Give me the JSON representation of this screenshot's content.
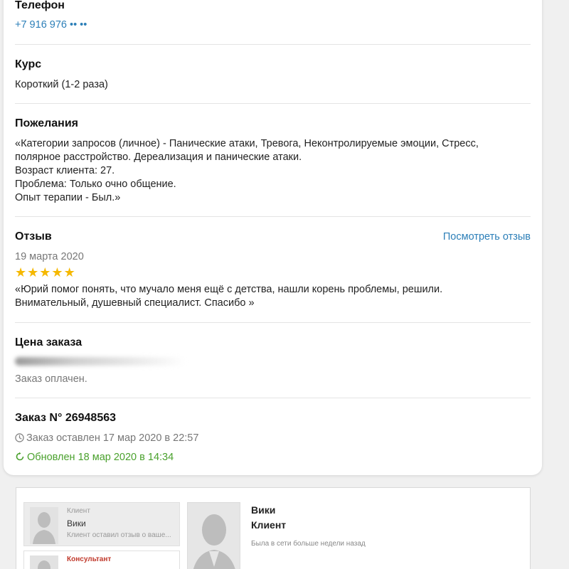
{
  "phone": {
    "label": "Телефон",
    "value": "+7 916 976 •• ••"
  },
  "course": {
    "label": "Курс",
    "value": "Короткий (1-2 раза)"
  },
  "wishes": {
    "label": "Пожелания",
    "lines": [
      "«Категории запросов (личное) - Панические атаки, Тревога, Неконтролируемые эмоции, Стресс,",
      "полярное расстройство. Дереализация и панические атаки.",
      "Возраст клиента: 27.",
      "Проблема: Только очно общение.",
      "Опыт терапии - Был.»"
    ]
  },
  "review": {
    "label": "Отзыв",
    "link": "Посмотреть отзыв",
    "date": "19 марта 2020",
    "rating": 5,
    "stars": [
      "★",
      "★",
      "★",
      "★",
      "★"
    ],
    "lines": [
      "«Юрий помог понять, что мучало меня ещё с детства, нашли корень проблемы, решили.",
      "Внимательный, душевный специалист. Спасибо »"
    ]
  },
  "price": {
    "label": "Цена заказа",
    "status": "Заказ оплачен."
  },
  "order": {
    "title": "Заказ N° 26948563",
    "created": "Заказ оставлен 17 мар 2020 в 22:57",
    "updated": "Обновлен 18 мар 2020 в 14:34"
  },
  "chat": {
    "items": [
      {
        "role": "Клиент",
        "name": "Вики",
        "message": "Клиент оставил отзыв о ваше..."
      },
      {
        "role": "Консультант",
        "name": "",
        "message": ""
      }
    ],
    "profile": {
      "name": "Вики",
      "role": "Клиент",
      "status": "Была в сети больше недели назад"
    }
  },
  "colors": {
    "link": "#2c7fb8",
    "green": "#4aa12d",
    "star": "#f5b800"
  }
}
